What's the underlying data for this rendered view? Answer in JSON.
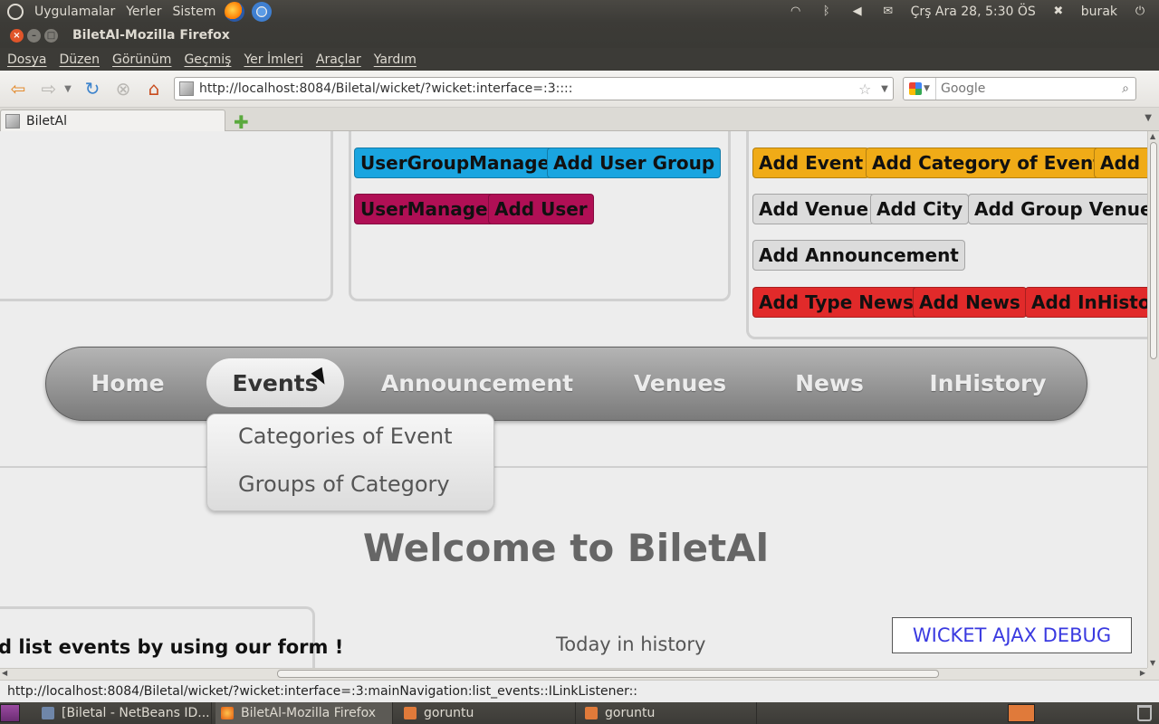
{
  "top_panel": {
    "menus": [
      "Uygulamalar",
      "Yerler",
      "Sistem"
    ],
    "clock": "Çrş Ara 28,  5:30 ÖS",
    "user": "burak"
  },
  "window": {
    "title": "BiletAl-Mozilla Firefox"
  },
  "menubar": {
    "items": [
      "Dosya",
      "Düzen",
      "Görünüm",
      "Geçmiş",
      "Yer İmleri",
      "Araçlar",
      "Yardım"
    ]
  },
  "navbar": {
    "url": "http://localhost:8084/Biletal/wicket/?wicket:interface=:3::::",
    "search_placeholder": "Google"
  },
  "tabs": [
    {
      "label": "BiletAl"
    }
  ],
  "admin": {
    "mid_row1": [
      "UserGroupManage",
      "Add User Group"
    ],
    "mid_row2": [
      "UserManage",
      "Add User"
    ],
    "right_row1": [
      "Add Event",
      "Add Category of Event",
      "Add C"
    ],
    "right_row2": [
      "Add Venue",
      "Add City",
      "Add Group Venue"
    ],
    "right_row3": [
      "Add Announcement"
    ],
    "right_row4": [
      "Add Type News",
      "Add News",
      "Add InHistor"
    ]
  },
  "main_nav": {
    "items": [
      "Home",
      "Events",
      "Announcement",
      "Venues",
      "News",
      "InHistory"
    ],
    "active": "Events",
    "dropdown": [
      "Categories of Event",
      "Groups of Category"
    ]
  },
  "page": {
    "welcome": "Welcome to BiletAl",
    "form_title": "d list events by using our form !",
    "history_label": "Today in history",
    "debug_button": "WICKET AJAX DEBUG"
  },
  "statusbar": {
    "text": "http://localhost:8084/Biletal/wicket/?wicket:interface=:3:mainNavigation:list_events::ILinkListener::"
  },
  "taskbar": {
    "tasks": [
      "[Biletal - NetBeans ID...",
      "BiletAl-Mozilla Firefox",
      "goruntu",
      "goruntu"
    ]
  }
}
